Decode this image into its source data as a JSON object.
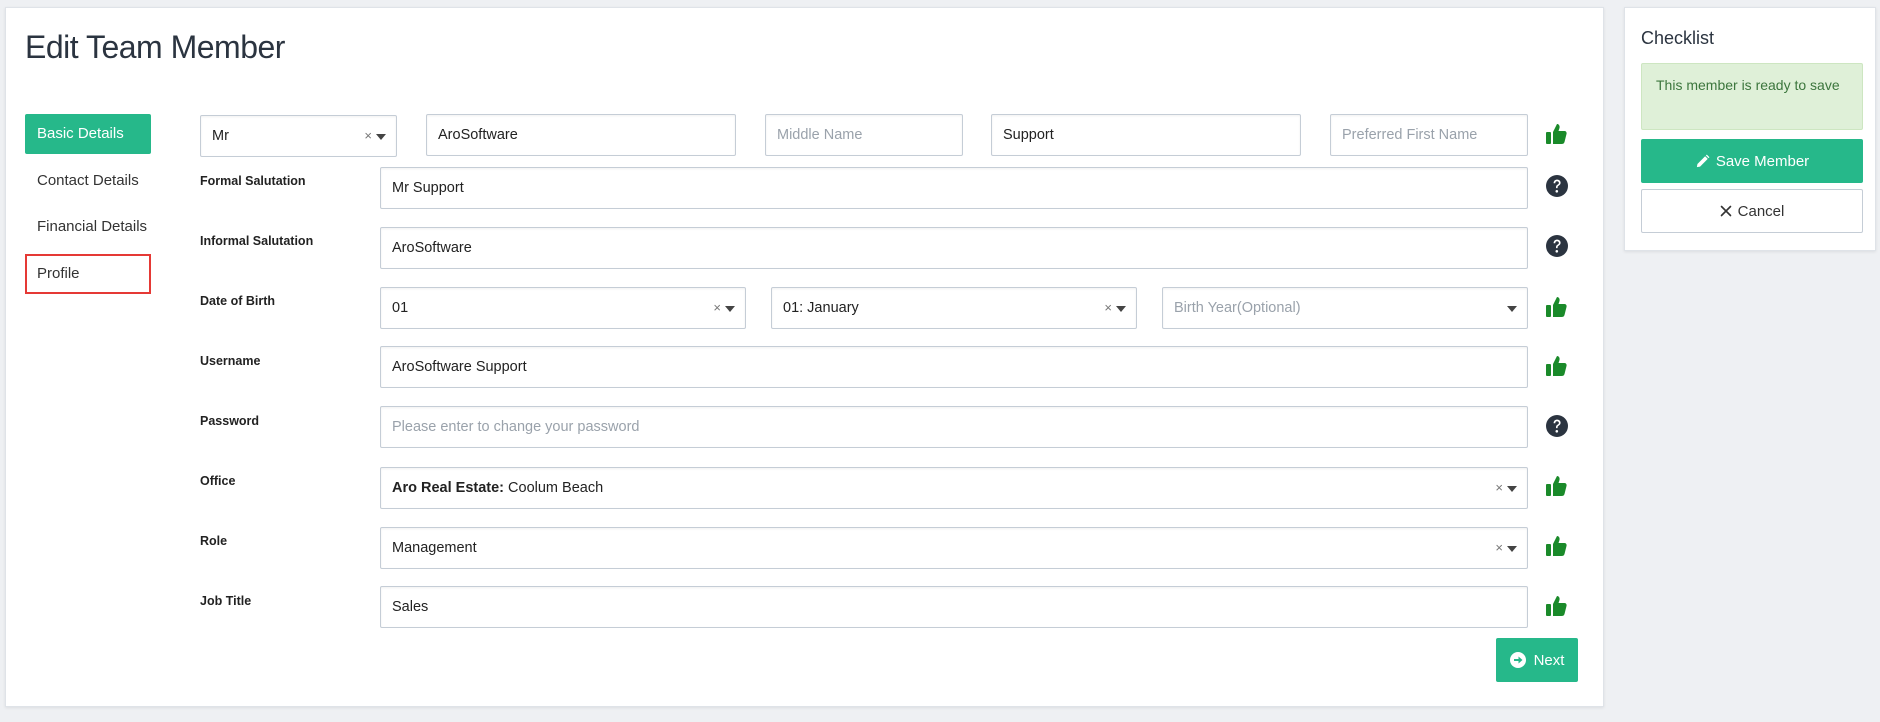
{
  "page_title": "Edit Team Member",
  "sidebar": {
    "items": [
      {
        "label": "Basic Details"
      },
      {
        "label": "Contact Details"
      },
      {
        "label": "Financial Details"
      },
      {
        "label": "Profile"
      }
    ]
  },
  "name_row": {
    "title_value": "Mr",
    "first_name_value": "AroSoftware",
    "middle_name_placeholder": "Middle Name",
    "last_name_value": "Support",
    "preferred_name_placeholder": "Preferred First Name",
    "status_icon": "thumbs-up-icon"
  },
  "form": {
    "formal_salutation": {
      "label": "Formal Salutation",
      "value": "Mr Support",
      "status_icon": "question-circle-icon"
    },
    "informal_salutation": {
      "label": "Informal Salutation",
      "value": "AroSoftware",
      "status_icon": "question-circle-icon"
    },
    "date_of_birth": {
      "label": "Date of Birth",
      "day_value": "01",
      "month_value": "01: January",
      "year_placeholder": "Birth Year(Optional)",
      "status_icon": "thumbs-up-icon"
    },
    "username": {
      "label": "Username",
      "value": "AroSoftware Support",
      "status_icon": "thumbs-up-icon"
    },
    "password": {
      "label": "Password",
      "placeholder": "Please enter to change your password",
      "status_icon": "question-circle-icon"
    },
    "office": {
      "label": "Office",
      "value_bold": "Aro Real Estate:",
      "value_rest": " Coolum Beach",
      "status_icon": "thumbs-up-icon"
    },
    "role": {
      "label": "Role",
      "value": "Management",
      "status_icon": "thumbs-up-icon"
    },
    "job_title": {
      "label": "Job Title",
      "value": "Sales",
      "status_icon": "thumbs-up-icon"
    }
  },
  "clear_glyph": "×",
  "next_button": {
    "label": "Next"
  },
  "checklist": {
    "title": "Checklist",
    "alert_text": "This member is ready to save",
    "save_label": "Save Member",
    "cancel_label": "Cancel"
  },
  "colors": {
    "accent": "#26b88a",
    "success_icon": "#1a8a2a",
    "help_icon": "#2b3440",
    "highlight_border": "#e53935",
    "alert_bg": "#dff0d8",
    "alert_text": "#3c763d"
  }
}
